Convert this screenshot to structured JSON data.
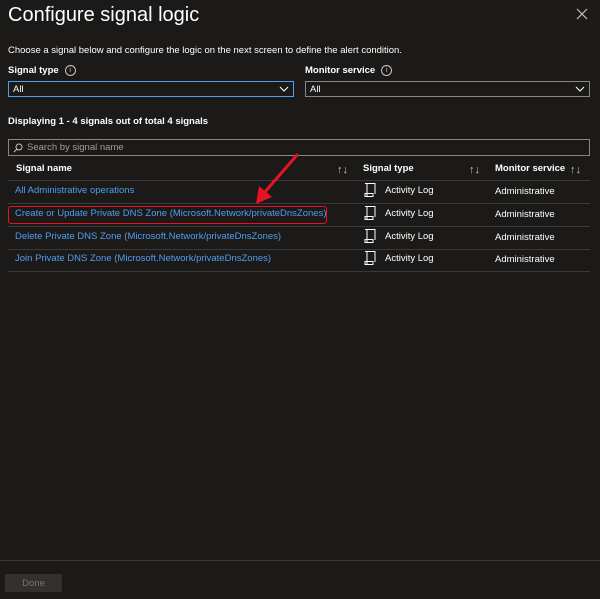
{
  "header": {
    "title": "Configure signal logic"
  },
  "description": "Choose a signal below and configure the logic on the next screen to define the alert condition.",
  "filters": {
    "signal_type": {
      "label": "Signal type",
      "value": "All"
    },
    "monitor_service": {
      "label": "Monitor service",
      "value": "All"
    }
  },
  "displaying_text": "Displaying 1 - 4 signals out of total 4 signals",
  "search": {
    "placeholder": "Search by signal name"
  },
  "table": {
    "columns": [
      "Signal name",
      "Signal type",
      "Monitor service"
    ],
    "rows": [
      {
        "name": "All Administrative operations",
        "type": "Activity Log",
        "service": "Administrative"
      },
      {
        "name": "Create or Update Private DNS Zone (Microsoft.Network/privateDnsZones)",
        "type": "Activity Log",
        "service": "Administrative"
      },
      {
        "name": "Delete Private DNS Zone (Microsoft.Network/privateDnsZones)",
        "type": "Activity Log",
        "service": "Administrative"
      },
      {
        "name": "Join Private DNS Zone (Microsoft.Network/privateDnsZones)",
        "type": "Activity Log",
        "service": "Administrative"
      }
    ],
    "row_icon": "activity-log-scroll-icon",
    "highlighted_row": 1
  },
  "annotation": {
    "color": "#e81123"
  },
  "footer": {
    "done_label": "Done"
  },
  "colors": {
    "background": "#1b1a19",
    "link": "#4f9ef0",
    "accent_border": "#4f9ef0",
    "highlight": "#e81123"
  }
}
